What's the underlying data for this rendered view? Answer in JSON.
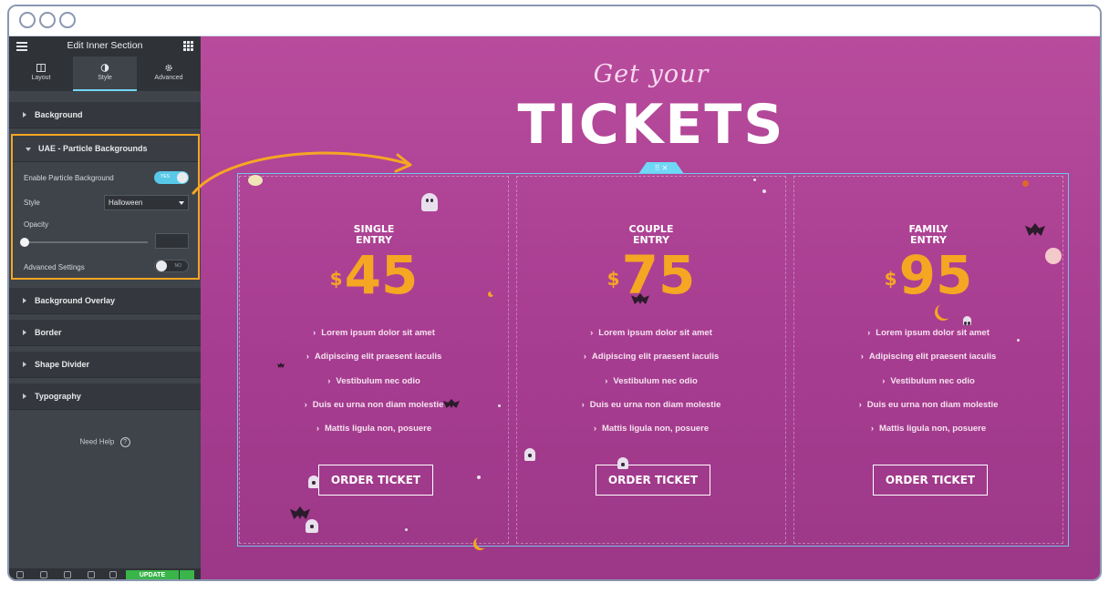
{
  "sidebar": {
    "header_title": "Edit Inner Section",
    "tabs": [
      {
        "label": "Layout",
        "icon": "layout-icon",
        "active": false
      },
      {
        "label": "Style",
        "icon": "style-icon",
        "active": true
      },
      {
        "label": "Advanced",
        "icon": "gear-icon",
        "active": false
      }
    ],
    "sections": {
      "background": "Background",
      "uae": "UAE - Particle Backgrounds",
      "background_overlay": "Background Overlay",
      "border": "Border",
      "shape_divider": "Shape Divider",
      "typography": "Typography"
    },
    "controls": {
      "enable_label": "Enable Particle Background",
      "enable_toggle": "YES",
      "style_label": "Style",
      "style_value": "Halloween",
      "opacity_label": "Opacity",
      "advanced_label": "Advanced Settings",
      "advanced_toggle": "NO"
    },
    "help": "Need Help",
    "help_icon": "?",
    "update": "UPDATE",
    "collapse_glyph": "‹"
  },
  "canvas": {
    "subtitle": "Get your",
    "title": "TICKETS",
    "handle_glyph": "⠿  ✕",
    "plans": [
      {
        "name_line1": "SINGLE",
        "name_line2": "ENTRY",
        "currency": "$",
        "price": "45"
      },
      {
        "name_line1": "COUPLE",
        "name_line2": "ENTRY",
        "currency": "$",
        "price": "75"
      },
      {
        "name_line1": "FAMILY",
        "name_line2": "ENTRY",
        "currency": "$",
        "price": "95"
      }
    ],
    "features": [
      "Lorem ipsum dolor sit amet",
      "Adipiscing elit praesent iaculis",
      "Vestibulum nec odio",
      "Duis eu urna non diam molestie",
      "Mattis ligula non, posuere"
    ],
    "button_label": "ORDER TICKET",
    "chevron": "›"
  },
  "colors": {
    "accent_orange": "#f5a623",
    "toggle_blue": "#58c8e8",
    "canvas_purple": "#a63c90",
    "update_green": "#39b54a"
  }
}
